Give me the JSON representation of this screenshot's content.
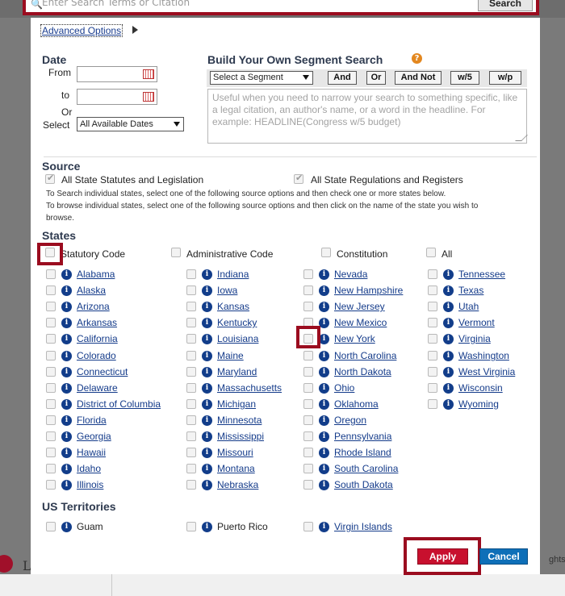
{
  "search": {
    "placeholder": "Enter Search Terms or Citation",
    "button": "Search"
  },
  "background": {
    "logo_letter": "L",
    "footer_text": "ghts r"
  },
  "advanced_options": "Advanced Options",
  "date": {
    "heading": "Date",
    "from_label": "From",
    "to_label": "to",
    "or_label": "Or",
    "select_label": "Select",
    "select_value": "All Available Dates"
  },
  "segment": {
    "heading": "Build Your Own Segment Search",
    "help_glyph": "?",
    "select_value": "Select a Segment",
    "operators": [
      "And",
      "Or",
      "And Not",
      "w/5",
      "w/p"
    ],
    "placeholder": "Useful when you need to narrow your search to something specific, like a legal citation, an author's name, or a word in the headline. For example: HEADLINE(Congress w/5 budget)"
  },
  "source": {
    "heading": "Source",
    "option1": "All State Statutes and Legislation",
    "option2": "All State Regulations and Registers",
    "help_line1": "To Search individual states, select one of the following source options and then check one or more states below.",
    "help_line2": "To browse individual states, select one of the following source options and then click on the name of the state you wish to",
    "help_line3": "browse."
  },
  "states": {
    "heading": "States",
    "source_options": [
      "Statutory Code",
      "Administrative Code",
      "Constitution",
      "All"
    ],
    "columns": [
      [
        "Alabama",
        "Alaska",
        "Arizona",
        "Arkansas",
        "California",
        "Colorado",
        "Connecticut",
        "Delaware",
        "District of Columbia",
        "Florida",
        "Georgia",
        "Hawaii",
        "Idaho",
        "Illinois"
      ],
      [
        "Indiana",
        "Iowa",
        "Kansas",
        "Kentucky",
        "Louisiana",
        "Maine",
        "Maryland",
        "Massachusetts",
        "Michigan",
        "Minnesota",
        "Mississippi",
        "Missouri",
        "Montana",
        "Nebraska"
      ],
      [
        "Nevada",
        "New Hampshire",
        "New Jersey",
        "New Mexico",
        "New York",
        "North Carolina",
        "North Dakota",
        "Ohio",
        "Oklahoma",
        "Oregon",
        "Pennsylvania",
        "Rhode Island",
        "South Carolina",
        "South Dakota"
      ],
      [
        "Tennessee",
        "Texas",
        "Utah",
        "Vermont",
        "Virginia",
        "Washington",
        "West Virginia",
        "Wisconsin",
        "Wyoming"
      ]
    ]
  },
  "territories": {
    "heading": "US Territories",
    "items": [
      "Guam",
      "Puerto Rico",
      "Virgin Islands"
    ]
  },
  "info_glyph": "i",
  "buttons": {
    "apply": "Apply",
    "cancel": "Cancel"
  },
  "colors": {
    "highlight": "#9b0c1f",
    "apply": "#c8102e",
    "cancel": "#0e6fb8",
    "link": "#143b8a",
    "heading": "#2e3a4f"
  }
}
